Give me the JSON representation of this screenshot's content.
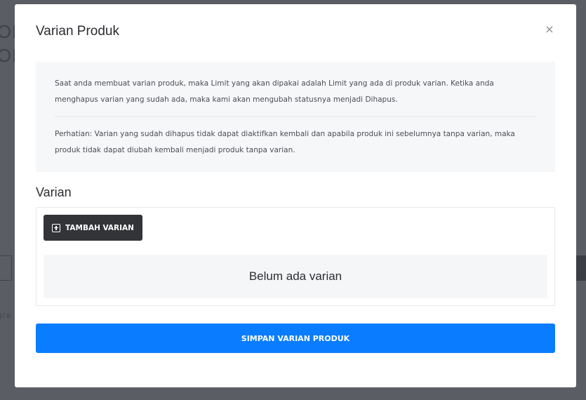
{
  "background": {
    "text_line_1": "ON",
    "text_line_2": "ON",
    "text_line_3": "gra"
  },
  "modal": {
    "title": "Varian Produk",
    "close_glyph": "×",
    "info": {
      "paragraph_1": "Saat anda membuat varian produk, maka Limit yang akan dipakai adalah Limit yang ada di produk varian. Ketika anda menghapus varian yang sudah ada, maka kami akan mengubah statusnya menjadi Dihapus.",
      "paragraph_2": "Perhatian: Varian yang sudah dihapus tidak dapat diaktifkan kembali dan apabila produk ini sebelumnya tanpa varian, maka produk tidak dapat diubah kembali menjadi produk tanpa varian."
    },
    "variants_section": {
      "title": "Varian",
      "add_button_label": "TAMBAH VARIAN",
      "add_button_icon": "plus-square-icon",
      "empty_message": "Belum ada varian"
    },
    "save_button_label": "SIMPAN VARIAN PRODUK"
  },
  "colors": {
    "primary": "#0a7cff",
    "dark_button": "#323438",
    "overlay": "#54575d"
  }
}
